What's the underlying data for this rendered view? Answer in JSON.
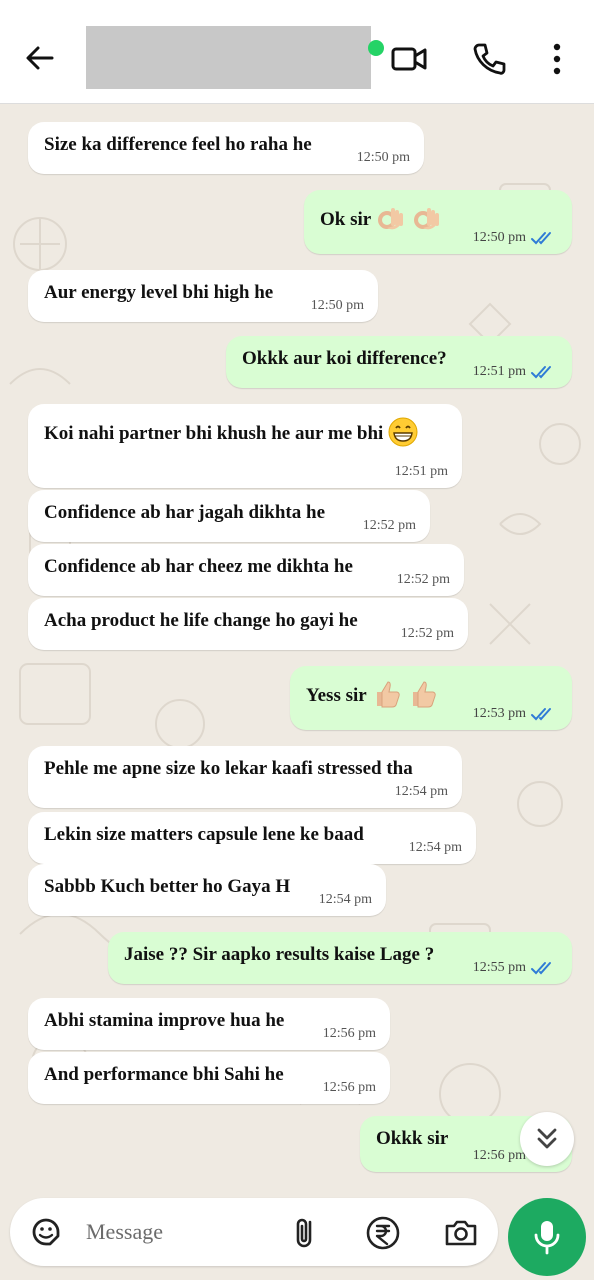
{
  "input": {
    "placeholder": "Message"
  },
  "messages": [
    {
      "dir": "in",
      "text": "Size ka difference feel ho raha he",
      "time": "12:50 pm"
    },
    {
      "dir": "out",
      "text": "Ok sir",
      "emoji": "ok-hand",
      "time": "12:50 pm"
    },
    {
      "dir": "in",
      "text": "Aur energy level bhi high he",
      "time": "12:50 pm"
    },
    {
      "dir": "out",
      "text": "Okkk aur koi difference?",
      "time": "12:51 pm"
    },
    {
      "dir": "in",
      "text": "Koi nahi partner bhi khush he aur me bhi",
      "emoji": "grin",
      "time": "12:51 pm"
    },
    {
      "dir": "in",
      "text": "Confidence ab har jagah dikhta he",
      "time": "12:52 pm"
    },
    {
      "dir": "in",
      "text": "Confidence ab har cheez me dikhta he",
      "time": "12:52 pm"
    },
    {
      "dir": "in",
      "text": "Acha product he life change ho gayi he",
      "time": "12:52 pm"
    },
    {
      "dir": "out",
      "text": "Yess sir",
      "emoji": "thumbs-up",
      "time": "12:53 pm"
    },
    {
      "dir": "in",
      "text": "Pehle me apne size ko lekar kaafi stressed tha",
      "time": "12:54 pm"
    },
    {
      "dir": "in",
      "text": "Lekin size matters capsule lene ke baad",
      "time": "12:54 pm"
    },
    {
      "dir": "in",
      "text": "Sabbb Kuch better ho Gaya H",
      "time": "12:54 pm"
    },
    {
      "dir": "out",
      "text": "Jaise ?? Sir aapko results kaise Lage ?",
      "time": "12:55 pm"
    },
    {
      "dir": "in",
      "text": "Abhi stamina improve hua he",
      "time": "12:56 pm"
    },
    {
      "dir": "in",
      "text": "And performance bhi Sahi he",
      "time": "12:56 pm"
    },
    {
      "dir": "out",
      "text": "Okkk sir",
      "time": "12:56 pm"
    }
  ],
  "colors": {
    "outgoing_bubble": "#d9fdd3",
    "incoming_bubble": "#ffffff",
    "chat_background": "#efeae2",
    "accent_green": "#1daa61",
    "read_ticks": "#2f7bd6"
  },
  "icons": [
    "back-arrow-icon",
    "video-call-icon",
    "phone-icon",
    "more-vert-icon",
    "sticker-icon",
    "attach-icon",
    "rupee-icon",
    "camera-icon",
    "mic-icon",
    "chevron-double-down-icon"
  ]
}
